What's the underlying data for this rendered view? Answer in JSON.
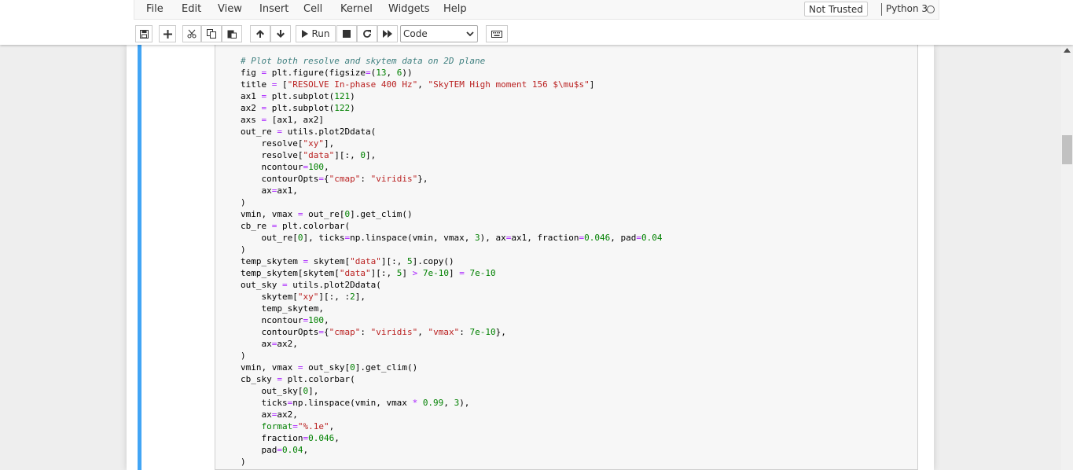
{
  "menu": {
    "items": [
      "File",
      "Edit",
      "View",
      "Insert",
      "Cell",
      "Kernel",
      "Widgets",
      "Help"
    ],
    "trust_status": "Not Trusted",
    "kernel_name": "Python 3"
  },
  "toolbar": {
    "run_label": "Run",
    "cell_type": "Code",
    "icons": [
      "save-icon",
      "plus-icon",
      "cut-icon",
      "copy-icon",
      "paste-icon",
      "arrow-up-icon",
      "arrow-down-icon",
      "play-icon",
      "stop-icon",
      "restart-icon",
      "fast-forward-icon",
      "keyboard-icon"
    ]
  },
  "colors": {
    "cell_selected_bar": "#42a5f5",
    "comment": "#408080",
    "string": "#ba2121",
    "number": "#008000",
    "operator": "#aa22ff"
  },
  "cell": {
    "lines": [
      [
        [
          "comment",
          "# Plot both resolve and skytem data on 2D plane"
        ]
      ],
      [
        [
          "plain",
          "fig "
        ],
        [
          "op",
          "="
        ],
        [
          "plain",
          " plt.figure(figsize"
        ],
        [
          "op",
          "="
        ],
        [
          "plain",
          "("
        ],
        [
          "num",
          "13"
        ],
        [
          "plain",
          ", "
        ],
        [
          "num",
          "6"
        ],
        [
          "plain",
          "))"
        ]
      ],
      [
        [
          "plain",
          "title "
        ],
        [
          "op",
          "="
        ],
        [
          "plain",
          " ["
        ],
        [
          "str",
          "\"RESOLVE In-phase 400 Hz\""
        ],
        [
          "plain",
          ", "
        ],
        [
          "str",
          "\"SkyTEM High moment 156 $\\mu$s\""
        ],
        [
          "plain",
          "]"
        ]
      ],
      [
        [
          "plain",
          "ax1 "
        ],
        [
          "op",
          "="
        ],
        [
          "plain",
          " plt.subplot("
        ],
        [
          "num",
          "121"
        ],
        [
          "plain",
          ")"
        ]
      ],
      [
        [
          "plain",
          "ax2 "
        ],
        [
          "op",
          "="
        ],
        [
          "plain",
          " plt.subplot("
        ],
        [
          "num",
          "122"
        ],
        [
          "plain",
          ")"
        ]
      ],
      [
        [
          "plain",
          "axs "
        ],
        [
          "op",
          "="
        ],
        [
          "plain",
          " [ax1, ax2]"
        ]
      ],
      [
        [
          "plain",
          "out_re "
        ],
        [
          "op",
          "="
        ],
        [
          "plain",
          " utils.plot2Ddata("
        ]
      ],
      [
        [
          "plain",
          "    resolve["
        ],
        [
          "str",
          "\"xy\""
        ],
        [
          "plain",
          "],"
        ]
      ],
      [
        [
          "plain",
          "    resolve["
        ],
        [
          "str",
          "\"data\""
        ],
        [
          "plain",
          "][:, "
        ],
        [
          "num",
          "0"
        ],
        [
          "plain",
          "],"
        ]
      ],
      [
        [
          "plain",
          "    ncontour"
        ],
        [
          "op",
          "="
        ],
        [
          "num",
          "100"
        ],
        [
          "plain",
          ","
        ]
      ],
      [
        [
          "plain",
          "    contourOpts"
        ],
        [
          "op",
          "="
        ],
        [
          "plain",
          "{"
        ],
        [
          "str",
          "\"cmap\""
        ],
        [
          "plain",
          ": "
        ],
        [
          "str",
          "\"viridis\""
        ],
        [
          "plain",
          "},"
        ]
      ],
      [
        [
          "plain",
          "    ax"
        ],
        [
          "op",
          "="
        ],
        [
          "plain",
          "ax1,"
        ]
      ],
      [
        [
          "plain",
          ")"
        ]
      ],
      [
        [
          "plain",
          "vmin, vmax "
        ],
        [
          "op",
          "="
        ],
        [
          "plain",
          " out_re["
        ],
        [
          "num",
          "0"
        ],
        [
          "plain",
          "].get_clim()"
        ]
      ],
      [
        [
          "plain",
          "cb_re "
        ],
        [
          "op",
          "="
        ],
        [
          "plain",
          " plt.colorbar("
        ]
      ],
      [
        [
          "plain",
          "    out_re["
        ],
        [
          "num",
          "0"
        ],
        [
          "plain",
          "], ticks"
        ],
        [
          "op",
          "="
        ],
        [
          "plain",
          "np.linspace(vmin, vmax, "
        ],
        [
          "num",
          "3"
        ],
        [
          "plain",
          "), ax"
        ],
        [
          "op",
          "="
        ],
        [
          "plain",
          "ax1, fraction"
        ],
        [
          "op",
          "="
        ],
        [
          "num",
          "0.046"
        ],
        [
          "plain",
          ", pad"
        ],
        [
          "op",
          "="
        ],
        [
          "num",
          "0.04"
        ]
      ],
      [
        [
          "plain",
          ")"
        ]
      ],
      [
        [
          "plain",
          "temp_skytem "
        ],
        [
          "op",
          "="
        ],
        [
          "plain",
          " skytem["
        ],
        [
          "str",
          "\"data\""
        ],
        [
          "plain",
          "][:, "
        ],
        [
          "num",
          "5"
        ],
        [
          "plain",
          "].copy()"
        ]
      ],
      [
        [
          "plain",
          "temp_skytem[skytem["
        ],
        [
          "str",
          "\"data\""
        ],
        [
          "plain",
          "][:, "
        ],
        [
          "num",
          "5"
        ],
        [
          "plain",
          "] "
        ],
        [
          "op",
          ">"
        ],
        [
          "plain",
          " "
        ],
        [
          "num",
          "7e-10"
        ],
        [
          "plain",
          "] "
        ],
        [
          "op",
          "="
        ],
        [
          "plain",
          " "
        ],
        [
          "num",
          "7e-10"
        ]
      ],
      [
        [
          "plain",
          "out_sky "
        ],
        [
          "op",
          "="
        ],
        [
          "plain",
          " utils.plot2Ddata("
        ]
      ],
      [
        [
          "plain",
          "    skytem["
        ],
        [
          "str",
          "\"xy\""
        ],
        [
          "plain",
          "][:, :"
        ],
        [
          "num",
          "2"
        ],
        [
          "plain",
          "],"
        ]
      ],
      [
        [
          "plain",
          "    temp_skytem,"
        ]
      ],
      [
        [
          "plain",
          "    ncontour"
        ],
        [
          "op",
          "="
        ],
        [
          "num",
          "100"
        ],
        [
          "plain",
          ","
        ]
      ],
      [
        [
          "plain",
          "    contourOpts"
        ],
        [
          "op",
          "="
        ],
        [
          "plain",
          "{"
        ],
        [
          "str",
          "\"cmap\""
        ],
        [
          "plain",
          ": "
        ],
        [
          "str",
          "\"viridis\""
        ],
        [
          "plain",
          ", "
        ],
        [
          "str",
          "\"vmax\""
        ],
        [
          "plain",
          ": "
        ],
        [
          "num",
          "7e-10"
        ],
        [
          "plain",
          "},"
        ]
      ],
      [
        [
          "plain",
          "    ax"
        ],
        [
          "op",
          "="
        ],
        [
          "plain",
          "ax2,"
        ]
      ],
      [
        [
          "plain",
          ")"
        ]
      ],
      [
        [
          "plain",
          "vmin, vmax "
        ],
        [
          "op",
          "="
        ],
        [
          "plain",
          " out_sky["
        ],
        [
          "num",
          "0"
        ],
        [
          "plain",
          "].get_clim()"
        ]
      ],
      [
        [
          "plain",
          "cb_sky "
        ],
        [
          "op",
          "="
        ],
        [
          "plain",
          " plt.colorbar("
        ]
      ],
      [
        [
          "plain",
          "    out_sky["
        ],
        [
          "num",
          "0"
        ],
        [
          "plain",
          "],"
        ]
      ],
      [
        [
          "plain",
          "    ticks"
        ],
        [
          "op",
          "="
        ],
        [
          "plain",
          "np.linspace(vmin, vmax "
        ],
        [
          "op",
          "*"
        ],
        [
          "plain",
          " "
        ],
        [
          "num",
          "0.99"
        ],
        [
          "plain",
          ", "
        ],
        [
          "num",
          "3"
        ],
        [
          "plain",
          "),"
        ]
      ],
      [
        [
          "plain",
          "    ax"
        ],
        [
          "op",
          "="
        ],
        [
          "plain",
          "ax2,"
        ]
      ],
      [
        [
          "plain",
          "    "
        ],
        [
          "kw",
          "format"
        ],
        [
          "op",
          "="
        ],
        [
          "str",
          "\"%.1e\""
        ],
        [
          "plain",
          ","
        ]
      ],
      [
        [
          "plain",
          "    fraction"
        ],
        [
          "op",
          "="
        ],
        [
          "num",
          "0.046"
        ],
        [
          "plain",
          ","
        ]
      ],
      [
        [
          "plain",
          "    pad"
        ],
        [
          "op",
          "="
        ],
        [
          "num",
          "0.04"
        ],
        [
          "plain",
          ","
        ]
      ],
      [
        [
          "plain",
          ")"
        ]
      ]
    ]
  }
}
